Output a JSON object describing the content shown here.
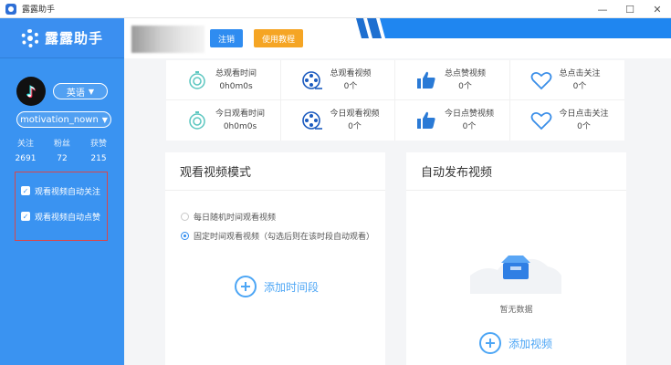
{
  "window": {
    "title": "露露助手",
    "controls": [
      "—",
      "☐",
      "✕"
    ]
  },
  "sidebar": {
    "brand": "露露助手",
    "language": "英语",
    "account": "motivation_nown",
    "stats": [
      {
        "label": "关注",
        "value": "2691"
      },
      {
        "label": "粉丝",
        "value": "72"
      },
      {
        "label": "获赞",
        "value": "215"
      }
    ],
    "options": [
      {
        "label": "观看视频自动关注",
        "checked": true
      },
      {
        "label": "观看视频自动点赞",
        "checked": true
      }
    ]
  },
  "header": {
    "register": "注销",
    "tutorial": "使用教程"
  },
  "summary": [
    {
      "label": "总观看时间",
      "value": "0h0m0s",
      "icon": "stopwatch-icon"
    },
    {
      "label": "总观看视频",
      "value": "0个",
      "icon": "film-reel-icon"
    },
    {
      "label": "总点赞视频",
      "value": "0个",
      "icon": "thumbs-up-icon"
    },
    {
      "label": "总点击关注",
      "value": "0个",
      "icon": "heart-icon"
    },
    {
      "label": "今日观看时间",
      "value": "0h0m0s",
      "icon": "stopwatch-icon"
    },
    {
      "label": "今日观看视频",
      "value": "0个",
      "icon": "film-reel-icon"
    },
    {
      "label": "今日点赞视频",
      "value": "0个",
      "icon": "thumbs-up-icon"
    },
    {
      "label": "今日点击关注",
      "value": "0个",
      "icon": "heart-icon"
    }
  ],
  "watch_panel": {
    "title": "观看视频模式",
    "options": [
      {
        "label": "每日随机时间观看视频",
        "selected": false
      },
      {
        "label": "固定时间观看视频（勾选后则在该时段自动观看）",
        "selected": true
      }
    ],
    "add_label": "添加时间段"
  },
  "publish_panel": {
    "title": "自动发布视频",
    "empty_text": "暂无数据",
    "add_label": "添加视频"
  },
  "colors": {
    "primary": "#3a93f1",
    "accent": "#f5a524",
    "link": "#4da6f5"
  }
}
